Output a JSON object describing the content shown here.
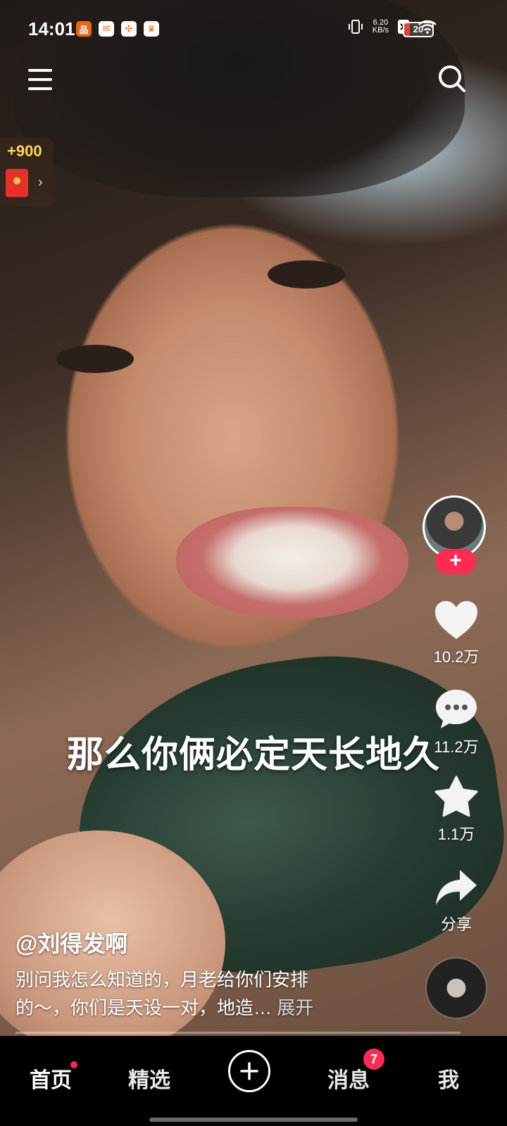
{
  "status_bar": {
    "time": "14:01",
    "net_speed_value": "6.20",
    "net_speed_unit": "KB/s",
    "battery": "20"
  },
  "coin_widget": {
    "reward": "+900"
  },
  "video": {
    "caption": "那么你俩必定天长地久",
    "progress_fraction": 0.0
  },
  "sidebar": {
    "likes": "10.2万",
    "comments": "11.2万",
    "favorites": "1.1万",
    "share": "分享"
  },
  "post": {
    "author": "@刘得发啊",
    "description_line1": "别问我怎么知道的，月老给你们安排",
    "description_line2": "的～，你们是天设一对，地造…",
    "expand": "展开"
  },
  "tabbar": {
    "home": "首页",
    "featured": "精选",
    "messages": "消息",
    "messages_badge": "7",
    "me": "我"
  }
}
